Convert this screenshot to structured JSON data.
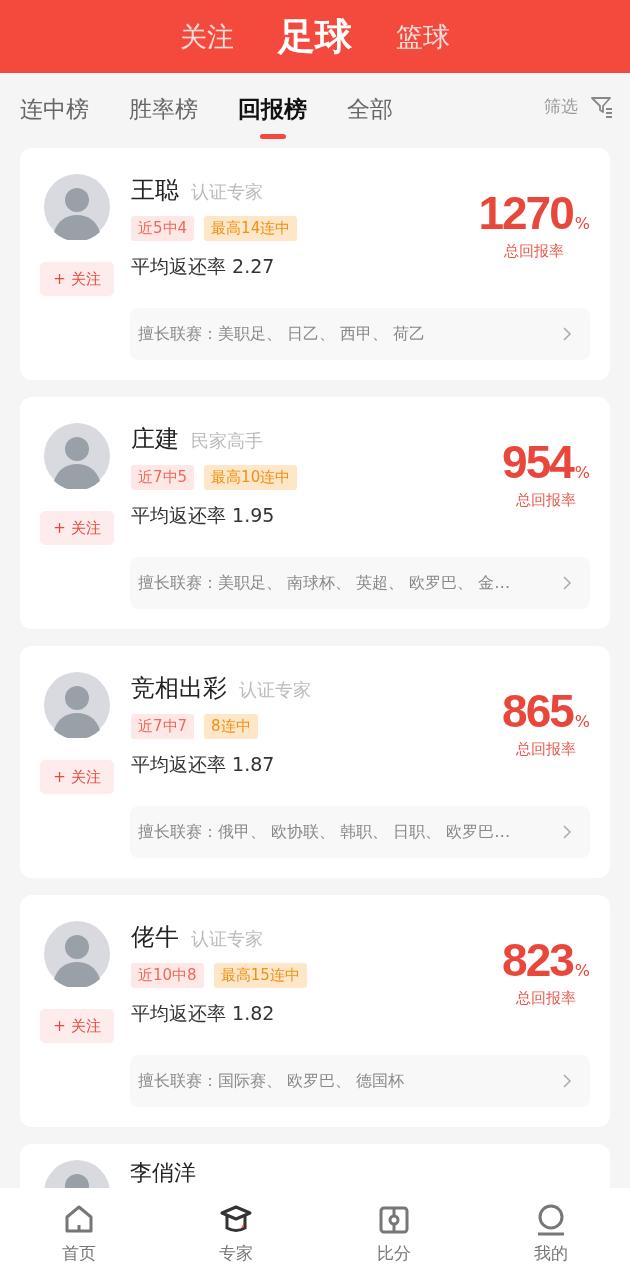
{
  "top_tabs": [
    {
      "label": "关注",
      "selected": false
    },
    {
      "label": "足球",
      "selected": true
    },
    {
      "label": "篮球",
      "selected": false
    }
  ],
  "sub_tabs": [
    {
      "label": "连中榜",
      "selected": false
    },
    {
      "label": "胜率榜",
      "selected": false
    },
    {
      "label": "回报榜",
      "selected": true
    },
    {
      "label": "全部",
      "selected": false
    }
  ],
  "filter": {
    "label": "筛选"
  },
  "experts": [
    {
      "name": "王聪",
      "title": "认证专家",
      "badges": [
        {
          "text": "近5中4",
          "kind": "recent"
        },
        {
          "text": "最高14连中",
          "kind": "streak"
        }
      ],
      "follow": "+ 关注",
      "avg_return": "平均返还率 2.27",
      "rate": "1270",
      "rate_unit": "%",
      "rate_label": "总回报率",
      "leagues": "擅长联赛：美职足、 日乙、 西甲、 荷乙"
    },
    {
      "name": "庄建",
      "title": "民家高手",
      "badges": [
        {
          "text": "近7中5",
          "kind": "recent"
        },
        {
          "text": "最高10连中",
          "kind": "streak"
        }
      ],
      "follow": "+ 关注",
      "avg_return": "平均返还率 1.95",
      "rate": "954",
      "rate_unit": "%",
      "rate_label": "总回报率",
      "leagues": "擅长联赛：美职足、 南球杯、 英超、 欧罗巴、 金…"
    },
    {
      "name": "竞相出彩",
      "title": "认证专家",
      "badges": [
        {
          "text": "近7中7",
          "kind": "recent"
        },
        {
          "text": "8连中",
          "kind": "streak"
        }
      ],
      "follow": "+ 关注",
      "avg_return": "平均返还率 1.87",
      "rate": "865",
      "rate_unit": "%",
      "rate_label": "总回报率",
      "leagues": "擅长联赛：俄甲、 欧协联、 韩职、 日职、 欧罗巴…"
    },
    {
      "name": "佬牛",
      "title": "认证专家",
      "badges": [
        {
          "text": "近10中8",
          "kind": "recent"
        },
        {
          "text": "最高15连中",
          "kind": "streak"
        }
      ],
      "follow": "+ 关注",
      "avg_return": "平均返还率 1.82",
      "rate": "823",
      "rate_unit": "%",
      "rate_label": "总回报率",
      "leagues": "擅长联赛：国际赛、 欧罗巴、 德国杯"
    }
  ],
  "partial_expert": {
    "name": "李俏洋"
  },
  "bottom_nav": [
    {
      "label": "首页",
      "kind": "home",
      "selected": false
    },
    {
      "label": "专家",
      "kind": "expert",
      "selected": true
    },
    {
      "label": "比分",
      "kind": "score",
      "selected": false
    },
    {
      "label": "我的",
      "kind": "me",
      "selected": false
    }
  ]
}
